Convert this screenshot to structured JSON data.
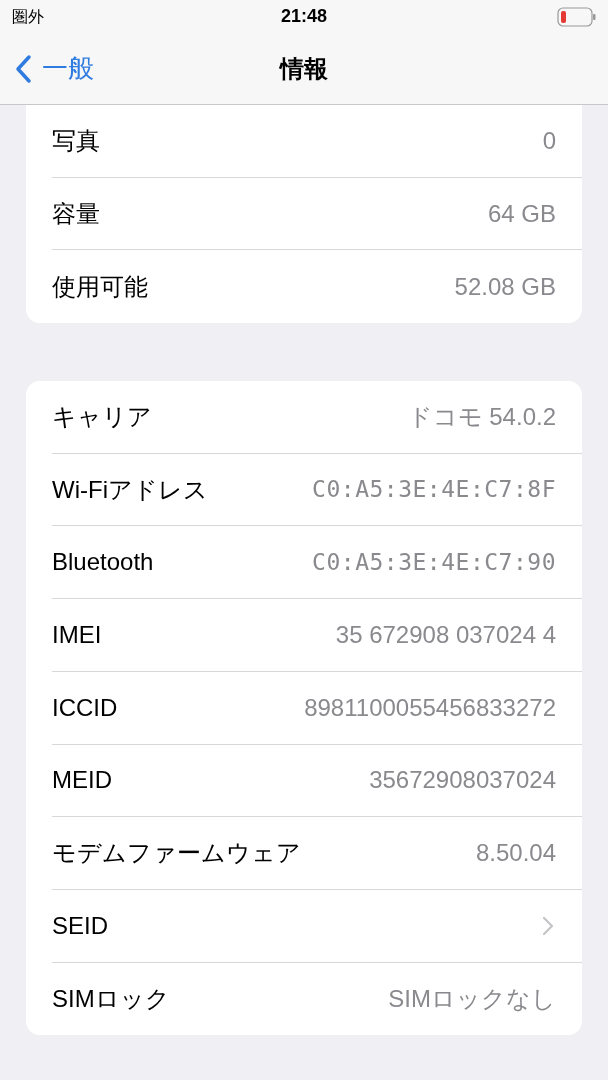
{
  "status_bar": {
    "carrier": "圏外",
    "time": "21:48"
  },
  "nav": {
    "back": "一般",
    "title": "情報"
  },
  "groups": [
    {
      "rows": [
        {
          "kind": "text",
          "label": "写真",
          "value": "0"
        },
        {
          "kind": "text",
          "label": "容量",
          "value": "64 GB"
        },
        {
          "kind": "text",
          "label": "使用可能",
          "value": "52.08 GB"
        }
      ]
    },
    {
      "rows": [
        {
          "kind": "text",
          "label": "キャリア",
          "value": "ドコモ 54.0.2"
        },
        {
          "kind": "mono",
          "label": "Wi-Fiアドレス",
          "value": "C0:A5:3E:4E:C7:8F"
        },
        {
          "kind": "mono",
          "label": "Bluetooth",
          "value": "C0:A5:3E:4E:C7:90"
        },
        {
          "kind": "text",
          "label": "IMEI",
          "value": "35 672908 037024 4"
        },
        {
          "kind": "text",
          "label": "ICCID",
          "value": "8981100055456833272"
        },
        {
          "kind": "text",
          "label": "MEID",
          "value": "35672908037024"
        },
        {
          "kind": "text",
          "label": "モデムファームウェア",
          "value": "8.50.04"
        },
        {
          "kind": "link",
          "label": "SEID"
        },
        {
          "kind": "text",
          "label": "SIMロック",
          "value": "SIMロックなし"
        }
      ]
    }
  ]
}
